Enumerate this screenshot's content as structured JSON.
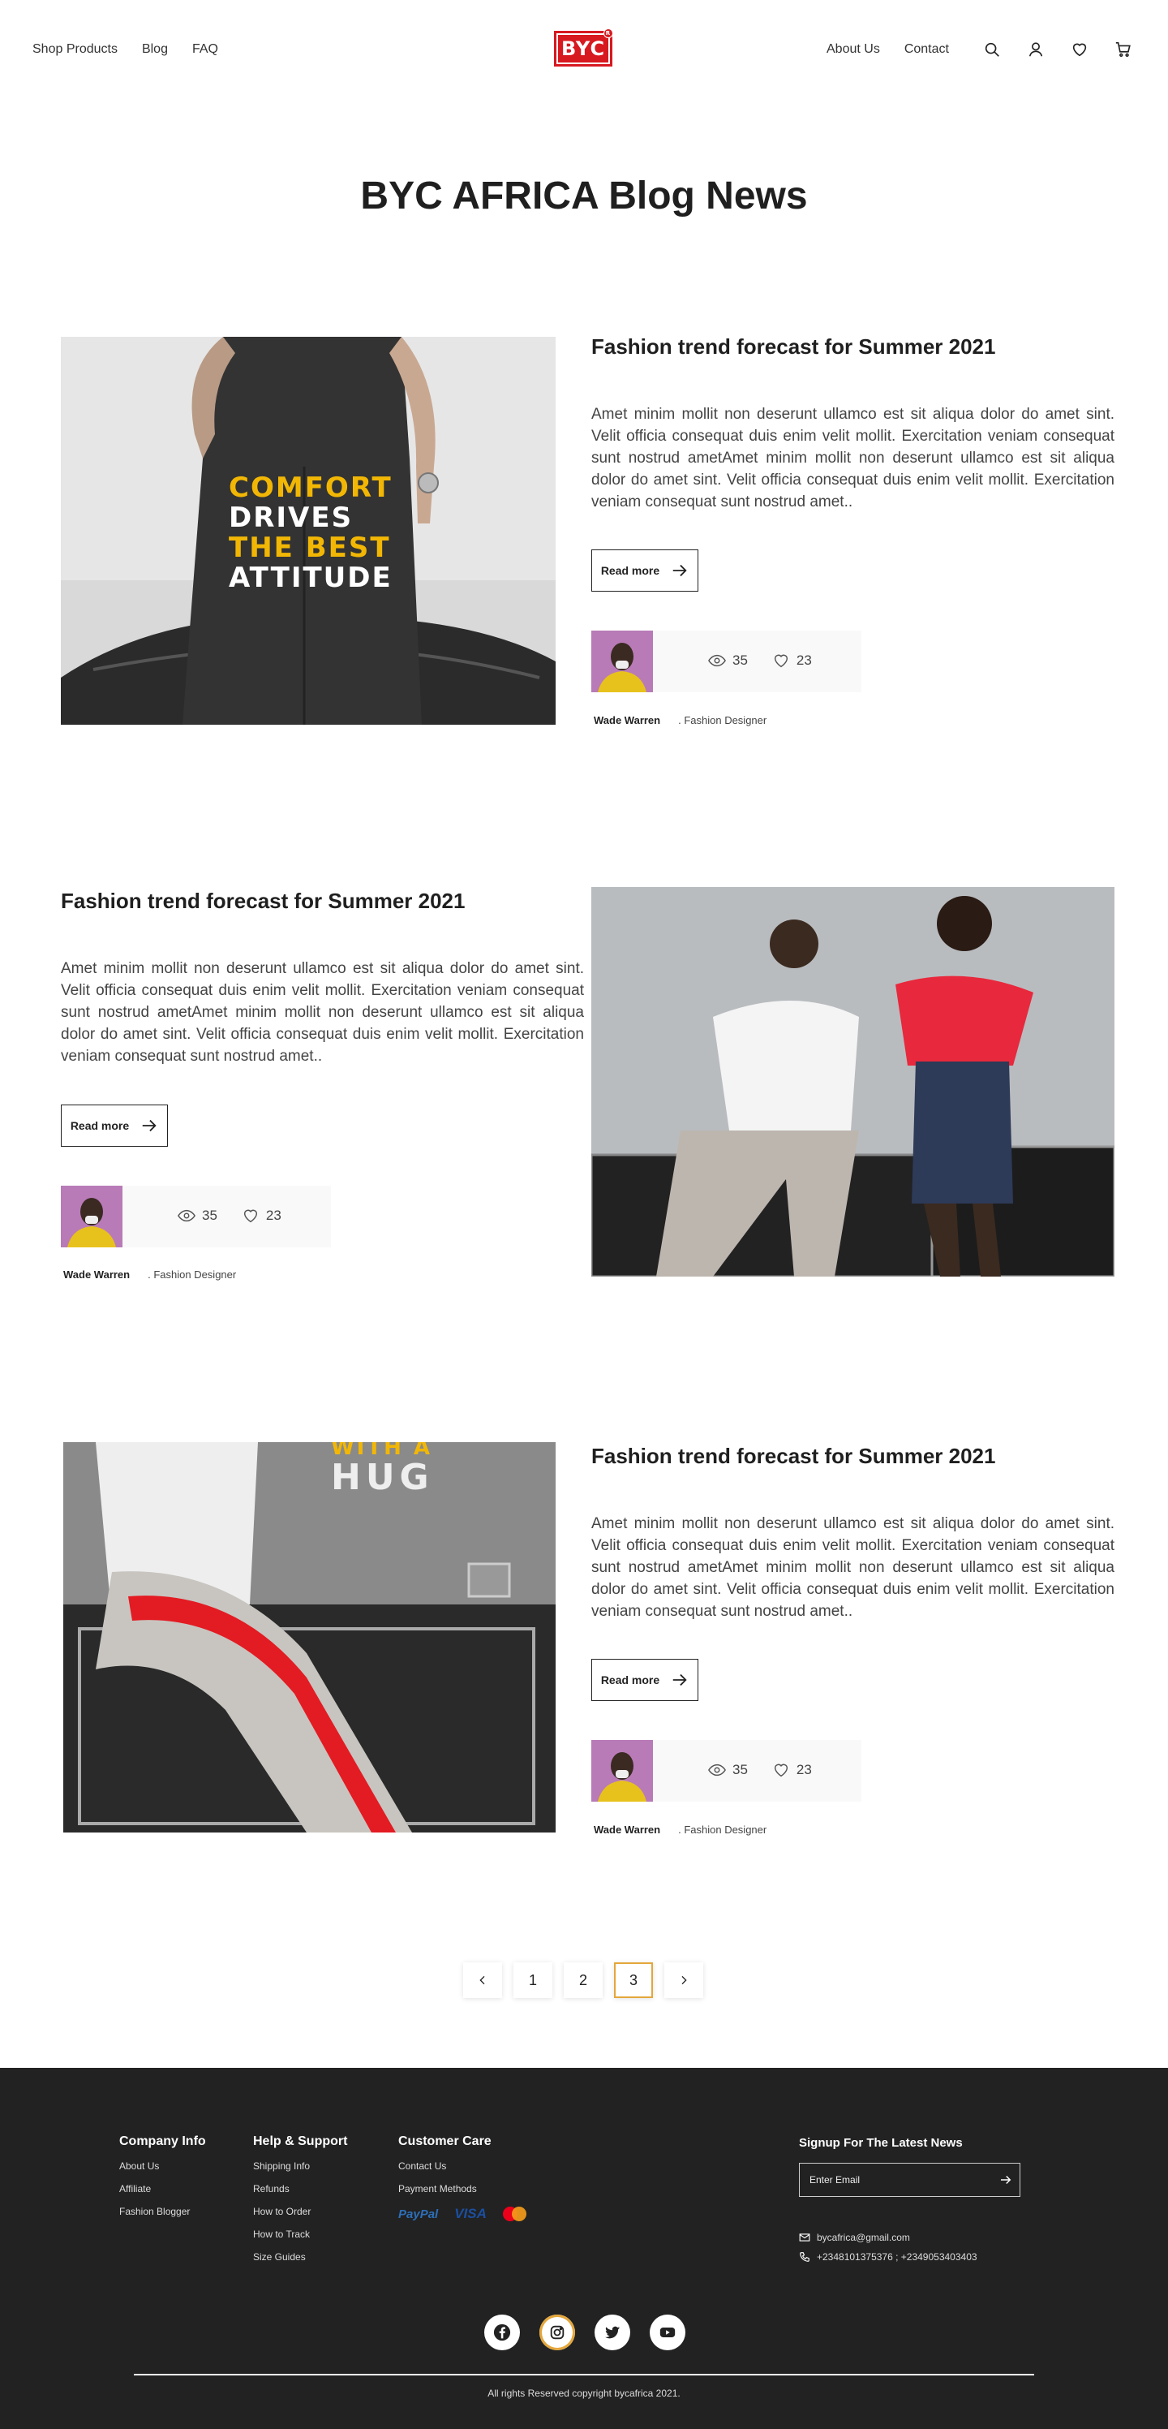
{
  "nav": {
    "left": [
      "Shop Products",
      "Blog",
      "FAQ"
    ],
    "logo": "BYC",
    "logo_reg": "R",
    "right": [
      "About Us",
      "Contact"
    ],
    "icons": [
      "search-icon",
      "user-icon",
      "heart-icon",
      "cart-icon"
    ]
  },
  "page_title": "BYC AFRICA Blog News",
  "posts": [
    {
      "title": "Fashion trend forecast for  Summer 2021",
      "excerpt": "Amet minim mollit non deserunt ullamco est sit aliqua dolor do amet sint. Velit officia consequat duis enim velit mollit. Exercitation veniam consequat sunt nostrud ametAmet minim mollit non deserunt ullamco est sit aliqua dolor do amet sint. Velit officia consequat duis enim velit mollit. Exercitation veniam consequat sunt nostrud amet..",
      "read_more": "Read more",
      "views": "35",
      "likes": "23",
      "author": "Wade Warren",
      "role": ". Fashion Designer",
      "image_text": [
        "COMFORT",
        "DRIVES",
        "THE BEST",
        "ATTITUDE"
      ]
    },
    {
      "title": "Fashion trend forecast for  Summer 2021",
      "excerpt": "Amet minim mollit non deserunt ullamco est sit aliqua dolor do amet sint. Velit officia consequat duis enim velit mollit. Exercitation veniam consequat sunt nostrud ametAmet minim mollit non deserunt ullamco est sit aliqua dolor do amet sint. Velit officia consequat duis enim velit mollit. Exercitation veniam consequat sunt nostrud amet..",
      "read_more": "Read more",
      "views": "35",
      "likes": "23",
      "author": "Wade Warren",
      "role": ". Fashion Designer"
    },
    {
      "title": "Fashion trend forecast for  Summer 2021",
      "excerpt": "Amet minim mollit non deserunt ullamco est sit aliqua dolor do amet sint. Velit officia consequat duis enim velit mollit. Exercitation veniam consequat sunt nostrud ametAmet minim mollit non deserunt ullamco est sit aliqua dolor do amet sint. Velit officia consequat duis enim velit mollit. Exercitation veniam consequat sunt nostrud amet..",
      "read_more": "Read more",
      "views": "35",
      "likes": "23",
      "author": "Wade Warren",
      "role": ". Fashion Designer",
      "image_text": [
        "WITH A",
        "HUG"
      ]
    }
  ],
  "pagination": {
    "pages": [
      "1",
      "2",
      "3"
    ],
    "active": "3"
  },
  "footer": {
    "company": {
      "title": "Company Info",
      "links": [
        "About Us",
        "Affiliate",
        "Fashion Blogger"
      ]
    },
    "help": {
      "title": "Help & Support",
      "links": [
        "Shipping Info",
        "Refunds",
        "How to Order",
        "How to Track",
        "Size Guides"
      ]
    },
    "care": {
      "title": "Customer Care",
      "links": [
        "Contact Us",
        "Payment Methods"
      ]
    },
    "payments": [
      "PayPal",
      "VISA"
    ],
    "signup": {
      "title": "Signup For The Latest News",
      "placeholder": "Enter Email"
    },
    "email": "bycafrica@gmail.com",
    "phone": "+2348101375376 ; +2349053403403",
    "socials": [
      "facebook-icon",
      "instagram-icon",
      "twitter-icon",
      "youtube-icon"
    ],
    "copyright": "All rights Reserved  copyright bycafrica 2021."
  },
  "colors": {
    "brand_red": "#d71920",
    "footer_bg": "#222222",
    "active_page_border": "#e4a73b"
  }
}
